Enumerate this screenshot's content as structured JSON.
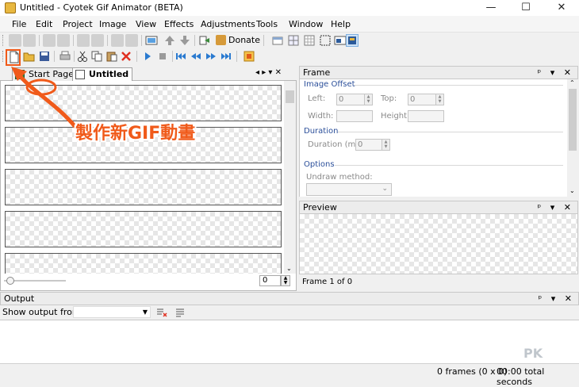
{
  "window": {
    "title": "Untitled - Cyotek Gif Animator (BETA)",
    "minimize": "—",
    "maximize": "☐",
    "close": "✕"
  },
  "menu": [
    "File",
    "Edit",
    "Project",
    "Image",
    "View",
    "Effects",
    "Adjustments",
    "Tools",
    "Window",
    "Help"
  ],
  "toolbar": {
    "donate_label": "Donate"
  },
  "tabs": {
    "start_page": "Start Page",
    "untitled": "Untitled",
    "controls": "◂ ▸ ▾ ✕"
  },
  "left_pane": {
    "zoom_value": "0"
  },
  "frame_panel": {
    "title": "Frame",
    "image_offset": "Image Offset",
    "left_label": "Left:",
    "left_value": "0",
    "top_label": "Top:",
    "top_value": "0",
    "width_label": "Width:",
    "height_label": "Height:",
    "duration": "Duration",
    "duration_label": "Duration (ms):",
    "duration_value": "0",
    "options": "Options",
    "undraw_label": "Undraw method:"
  },
  "preview_panel": {
    "title": "Preview",
    "frame_count": "Frame 1 of 0"
  },
  "panel_buttons": "ᵖ ▾ ✕",
  "output": {
    "title": "Output",
    "show_label": "Show output from:"
  },
  "status": {
    "frames": "0 frames (0 x 0)",
    "total": "00:00 total seconds"
  },
  "annotation": {
    "text": "製作新GIF動畫"
  },
  "watermark": "PK",
  "colors": {
    "annotation": "#f05a1a",
    "section_header": "#2b4f9a"
  }
}
